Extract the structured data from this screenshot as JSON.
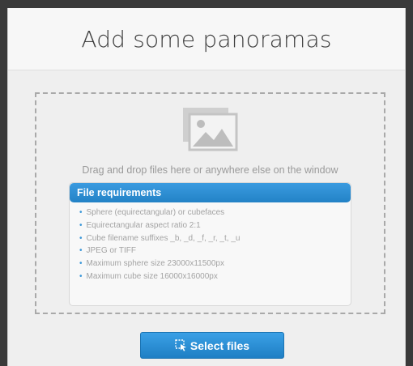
{
  "dialog": {
    "title": "Add some panoramas"
  },
  "dropzone": {
    "icon": "image-icon",
    "instruction": "Drag and drop files here or anywhere else on the window"
  },
  "requirements": {
    "heading": "File requirements",
    "items": [
      "Sphere (equirectangular) or cubefaces",
      "Equirectangular aspect ratio 2:1",
      "Cube filename suffixes _b, _d, _f, _r, _t, _u",
      "JPEG or TIFF",
      "Maximum sphere size 23000x11500px",
      "Maximum cube size 16000x16000px"
    ]
  },
  "actions": {
    "select_files_label": "Select files",
    "select_files_icon": "select-cursor-icon"
  },
  "colors": {
    "accent": "#2b8ed3",
    "dialog_background": "#efefef",
    "muted_text": "#9a9a9a"
  }
}
